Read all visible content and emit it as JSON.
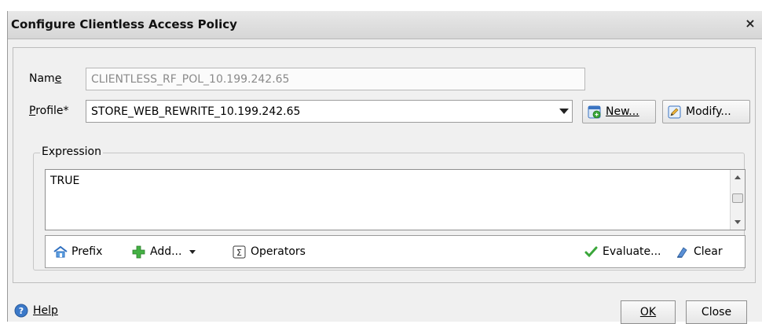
{
  "window": {
    "title": "Configure Clientless Access Policy"
  },
  "name": {
    "label": "Name",
    "value": "CLIENTLESS_RF_POL_10.199.242.65"
  },
  "profile": {
    "label": "Profile*",
    "value": "STORE_WEB_REWRITE_10.199.242.65",
    "new_label": "New...",
    "modify_label": "Modify..."
  },
  "expression": {
    "legend": "Expression",
    "value": "TRUE",
    "toolbar": {
      "prefix_label": "Prefix",
      "add_label": "Add...",
      "operators_label": "Operators",
      "evaluate_label": "Evaluate...",
      "clear_label": "Clear"
    }
  },
  "footer": {
    "help_label": "Help",
    "ok_label": "OK",
    "close_label": "Close"
  },
  "colors": {
    "titlebar": "#d6d6d6",
    "dialog_bg": "#f0f0f0",
    "link_blue": "#1a4fa3",
    "icon_green": "#3aa63a"
  },
  "icons": [
    "close-icon",
    "new-profile-icon",
    "modify-icon",
    "prefix-icon",
    "add-icon",
    "operators-icon",
    "evaluate-icon",
    "clear-icon",
    "help-icon",
    "dropdown-arrow-icon"
  ]
}
